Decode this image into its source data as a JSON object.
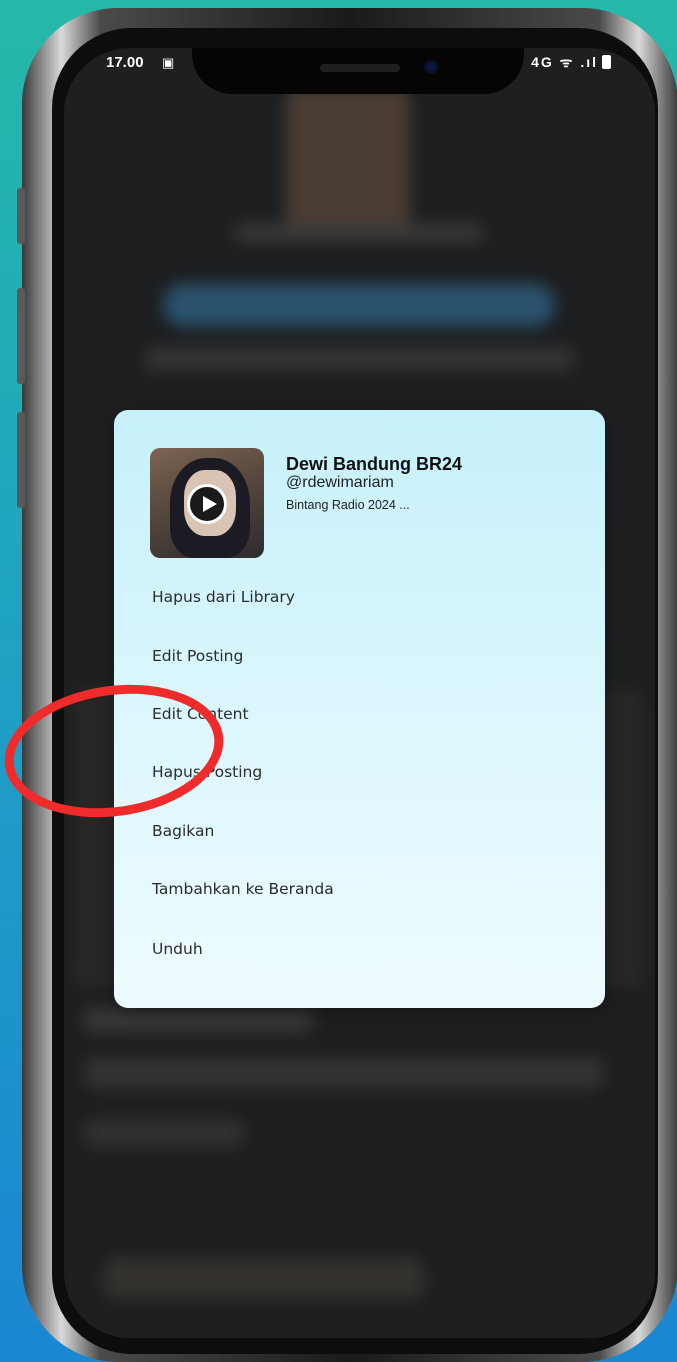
{
  "status_bar": {
    "time": "17.00",
    "signal": "4G ᯤ .ıl"
  },
  "post": {
    "title": "Dewi Bandung BR24",
    "handle": "@rdewimariam",
    "description": "Bintang Radio 2024 ..."
  },
  "menu": {
    "items": [
      "Hapus dari Library",
      "Edit Posting",
      "Edit Content",
      "Hapus Posting",
      "Bagikan",
      "Tambahkan ke Beranda",
      "Unduh"
    ]
  },
  "colors": {
    "highlight": "#f02b2b",
    "card": "#c7f1fb"
  }
}
